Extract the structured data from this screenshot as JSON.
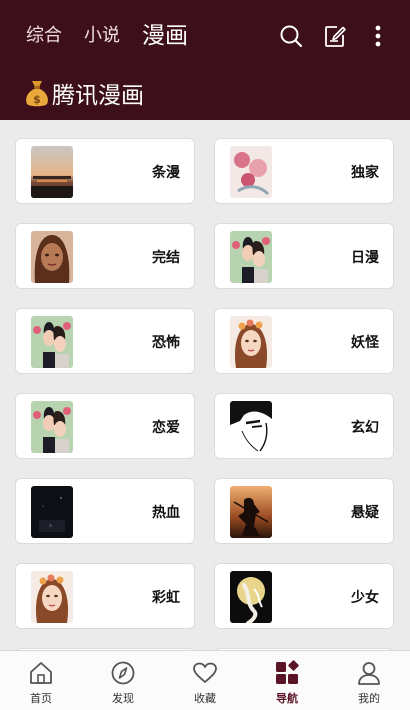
{
  "header": {
    "tabs": [
      "综合",
      "小说",
      "漫画"
    ],
    "active_tab": "漫画",
    "source_title": "腾讯漫画",
    "bg_color": "#3d0f1a"
  },
  "categories": [
    {
      "label": "条漫",
      "thumb": "sunset-city"
    },
    {
      "label": "独家",
      "thumb": "pink-floral"
    },
    {
      "label": "完结",
      "thumb": "brown-hair-girl"
    },
    {
      "label": "日漫",
      "thumb": "couple"
    },
    {
      "label": "恐怖",
      "thumb": "couple"
    },
    {
      "label": "妖怪",
      "thumb": "flower-girl"
    },
    {
      "label": "恋爱",
      "thumb": "couple"
    },
    {
      "label": "玄幻",
      "thumb": "ink-face"
    },
    {
      "label": "热血",
      "thumb": "dark-night"
    },
    {
      "label": "悬疑",
      "thumb": "warrior-sunset"
    },
    {
      "label": "彩虹",
      "thumb": "flower-girl"
    },
    {
      "label": "少女",
      "thumb": "moon-dragon"
    }
  ],
  "bottom_nav": [
    {
      "label": "首页",
      "icon": "home-icon"
    },
    {
      "label": "发现",
      "icon": "compass-icon"
    },
    {
      "label": "收藏",
      "icon": "heart-icon"
    },
    {
      "label": "导航",
      "icon": "grid-nav-icon",
      "active": true
    },
    {
      "label": "我的",
      "icon": "user-icon"
    }
  ],
  "colors": {
    "accent": "#5a1426",
    "background": "#ebebeb"
  }
}
